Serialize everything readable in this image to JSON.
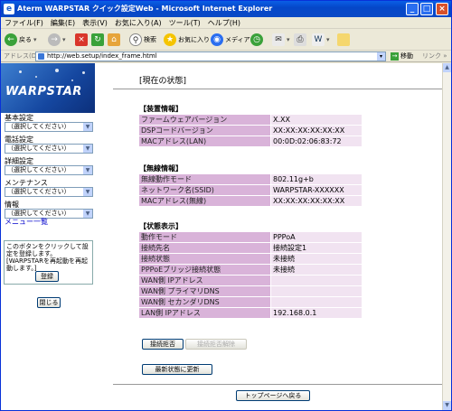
{
  "window": {
    "title": "Aterm WARPSTAR クイック設定Web - Microsoft Internet Explorer"
  },
  "menu": [
    "ファイル(F)",
    "編集(E)",
    "表示(V)",
    "お気に入り(A)",
    "ツール(T)",
    "ヘルプ(H)"
  ],
  "toolbar": {
    "back": "戻る",
    "search": "検索",
    "favorites": "お気に入り",
    "media": "メディア"
  },
  "address": {
    "label": "アドレス(D)",
    "url": "http://web.setup/index_frame.html",
    "go": "移動",
    "links": "リンク »"
  },
  "sidebar": {
    "logo": "WARPSTAR",
    "groups": [
      {
        "label": "基本設定",
        "value": "（選択してください）"
      },
      {
        "label": "電話設定",
        "value": "（選択してください）"
      },
      {
        "label": "詳細設定",
        "value": "（選択してください）"
      },
      {
        "label": "メンテナンス",
        "value": "（選択してください）"
      },
      {
        "label": "情報",
        "value": "（選択してください）"
      }
    ],
    "menu_link": "メニュー一覧",
    "note": "このボタンをクリックして設定を登録します。[WARPSTARを再起動を再起動します。]",
    "register": "登録",
    "close": "閉じる"
  },
  "main": {
    "title": "[現在の状態]",
    "device_header": "【装置情報】",
    "device_rows": [
      {
        "k": "ファームウェアバージョン",
        "v": "X.XX"
      },
      {
        "k": "DSPコードバージョン",
        "v": "XX:XX:XX:XX:XX:XX"
      },
      {
        "k": "MACアドレス(LAN)",
        "v": "00:0D:02:06:83:72"
      }
    ],
    "wireless_header": "【無線情報】",
    "wireless_rows": [
      {
        "k": "無線動作モード",
        "v": "802.11g+b"
      },
      {
        "k": "ネットワーク名(SSID)",
        "v": "WARPSTAR-XXXXXX"
      },
      {
        "k": "MACアドレス(無線)",
        "v": "XX:XX:XX:XX:XX:XX"
      }
    ],
    "status_header": "【状態表示】",
    "status_rows": [
      {
        "k": "動作モード",
        "v": "PPPoA"
      },
      {
        "k": "接続先名",
        "v": "接続設定1"
      },
      {
        "k": "接続状態",
        "v": "未接続"
      },
      {
        "k": "PPPoEブリッジ接続状態",
        "v": "未接続"
      },
      {
        "k": "WAN側 IPアドレス",
        "v": ""
      },
      {
        "k": "WAN側 プライマリDNS",
        "v": ""
      },
      {
        "k": "WAN側 セカンダリDNS",
        "v": ""
      },
      {
        "k": "LAN側 IPアドレス",
        "v": "192.168.0.1"
      }
    ],
    "btn_reject": "接続拒否",
    "btn_reject_cancel": "接続拒否解除",
    "btn_refresh": "最新状態に更新",
    "btn_top": "トップページへ戻る"
  }
}
